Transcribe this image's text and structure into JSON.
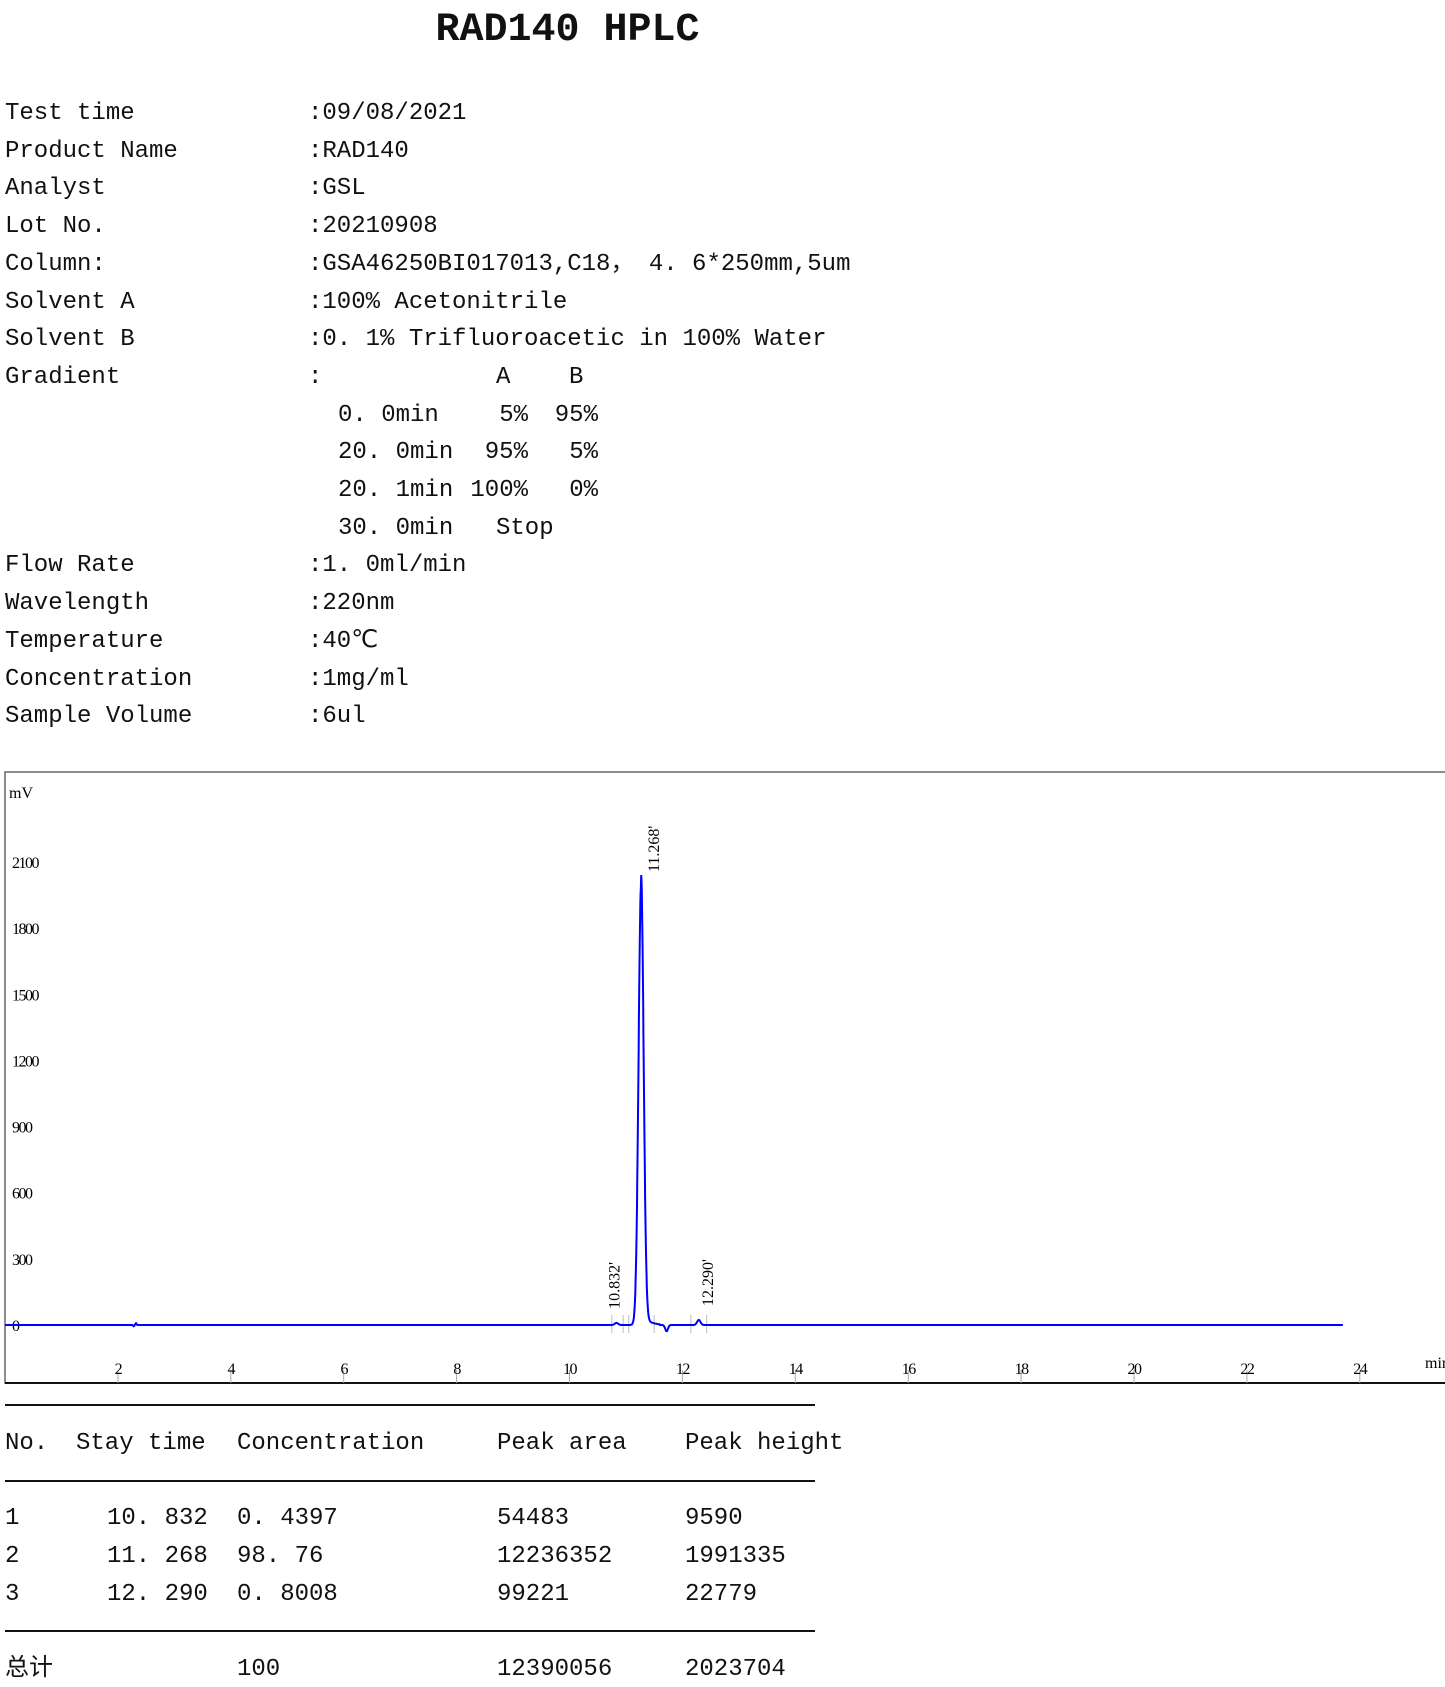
{
  "title": "RAD140 HPLC",
  "info": [
    {
      "label": "Test time",
      "value": ":09/08/2021"
    },
    {
      "label": "Product Name",
      "value": ":RAD140"
    },
    {
      "label": "Analyst",
      "value": ":GSL"
    },
    {
      "label": "Lot No.",
      "value": ":20210908"
    },
    {
      "label": "Column:",
      "value": ":GSA46250BI017013,C18， 4. 6*250mm,5um"
    },
    {
      "label": "Solvent A",
      "value": ":100% Acetonitrile"
    },
    {
      "label": "Solvent B",
      "value": ":0. 1% Trifluoroacetic in 100% Water"
    },
    {
      "label": "Gradient",
      "value": ":"
    }
  ],
  "gradient": {
    "header": {
      "a": "A",
      "b": "B"
    },
    "rows": [
      {
        "time": "0. 0min",
        "a": "5%",
        "b": "95%"
      },
      {
        "time": "20. 0min",
        "a": "95%",
        "b": "5%"
      },
      {
        "time": "20. 1min",
        "a": "100%",
        "b": "0%"
      },
      {
        "time": "30. 0min",
        "a": "Stop",
        "b": ""
      }
    ]
  },
  "info2": [
    {
      "label": "Flow Rate",
      "value": ":1. 0ml/min"
    },
    {
      "label": "Wavelength",
      "value": ":220nm"
    },
    {
      "label": "Temperature",
      "value": ":40℃"
    },
    {
      "label": "Concentration",
      "value": ":1mg/ml"
    },
    {
      "label": "Sample Volume",
      "value": ":6ul"
    }
  ],
  "chart_data": {
    "type": "line",
    "ylabel": "mV",
    "xlabel": "min",
    "xlim": [
      0,
      25
    ],
    "ylim": [
      -150,
      2350
    ],
    "x_ticks": [
      2,
      4,
      6,
      8,
      10,
      12,
      14,
      16,
      18,
      20,
      22,
      24
    ],
    "y_ticks": [
      0,
      300,
      600,
      900,
      1200,
      1500,
      1800,
      2100
    ],
    "trace_end": 23.7,
    "line_color": "#0000ff",
    "peaks": [
      {
        "label": "10.832'",
        "rt": 10.832,
        "height": 9.6
      },
      {
        "label": "11.268'",
        "rt": 11.268,
        "height": 1991
      },
      {
        "label": "12.290'",
        "rt": 12.29,
        "height": 22.8
      }
    ]
  },
  "table": {
    "headers": [
      "No.",
      "Stay time",
      "Concentration",
      "Peak area",
      "Peak height"
    ],
    "rows": [
      [
        "1",
        "10. 832",
        "0. 4397",
        "54483",
        "9590"
      ],
      [
        "2",
        "11. 268",
        "98. 76",
        "12236352",
        "1991335"
      ],
      [
        "3",
        "12. 290",
        "0. 8008",
        "99221",
        "22779"
      ]
    ],
    "total": [
      "总计",
      "100",
      "12390056",
      "2023704"
    ]
  }
}
